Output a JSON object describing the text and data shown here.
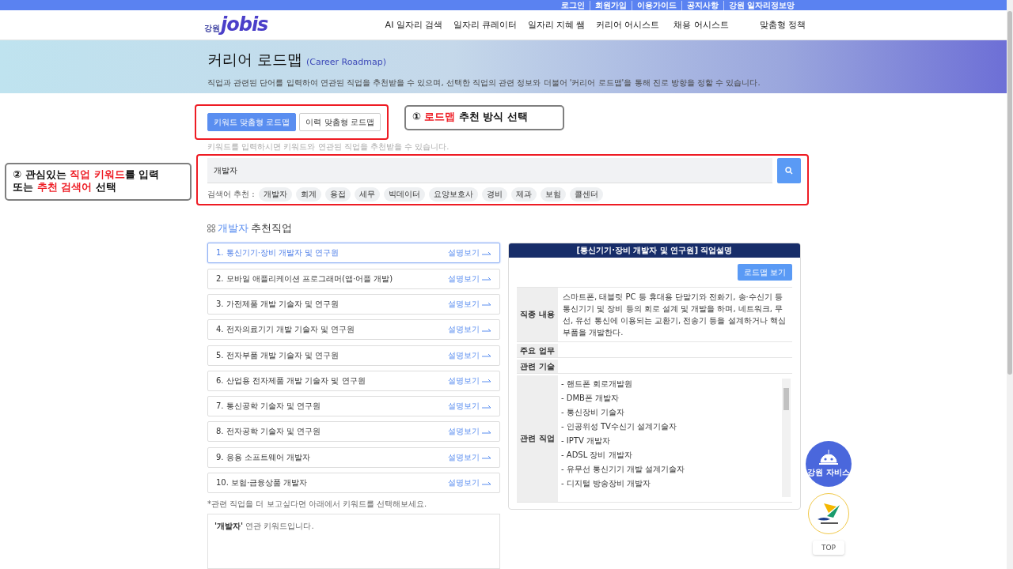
{
  "top_links": [
    "로그인",
    "회원가입",
    "이용가이드",
    "공지사항",
    "강원 일자리정보망"
  ],
  "logo": {
    "region": "강원",
    "name": "jobis"
  },
  "nav": [
    "AI 일자리 검색",
    "일자리 큐레이터",
    "일자리 지혜 쌤",
    "커리어 어시스트",
    "채용 어시스트",
    "맞춤형 정책"
  ],
  "banner": {
    "title": "커리어 로드맵",
    "subtitle": "(Career Roadmap)",
    "description": "직업과 관련된 단어를 입력하여 연관된 직업을 추천받을 수 있으며, 선택한 직업의 관련 정보와 더불어 '커리어 로드맵'을 통해 진로 방향을 정할 수 있습니다."
  },
  "tabs": [
    {
      "label": "키워드 맞춤형 로드맵",
      "selected": true
    },
    {
      "label": "이력 맞춤형 로드맵",
      "selected": false
    }
  ],
  "hint": "키워드를 입력하시면 키워드와 연관된 직업을 추천받을 수 있습니다.",
  "search": {
    "value": "개발자"
  },
  "suggest": {
    "label": "검색어 추천 :",
    "chips": [
      "개발자",
      "회계",
      "용접",
      "세무",
      "빅데이터",
      "요양보호사",
      "경비",
      "제과",
      "보험",
      "콜센터"
    ]
  },
  "section": {
    "keyword": "개발자",
    "rest": "추천직업"
  },
  "jobs": [
    {
      "title": "1. 통신기기·장비 개발자 및 연구원",
      "link": "설명보기",
      "selected": true
    },
    {
      "title": "2. 모바일 애플리케이션 프로그래머(앱·어플 개발)",
      "link": "설명보기",
      "selected": false
    },
    {
      "title": "3. 가전제품 개발 기술자 및 연구원",
      "link": "설명보기",
      "selected": false
    },
    {
      "title": "4. 전자의료기기 개발 기술자 및 연구원",
      "link": "설명보기",
      "selected": false
    },
    {
      "title": "5. 전자부품 개발 기술자 및 연구원",
      "link": "설명보기",
      "selected": false
    },
    {
      "title": "6. 산업용 전자제품 개발 기술자 및 연구원",
      "link": "설명보기",
      "selected": false
    },
    {
      "title": "7. 통신공학 기술자 및 연구원",
      "link": "설명보기",
      "selected": false
    },
    {
      "title": "8. 전자공학 기술자 및 연구원",
      "link": "설명보기",
      "selected": false
    },
    {
      "title": "9. 응용 소프트웨어 개발자",
      "link": "설명보기",
      "selected": false
    },
    {
      "title": "10. 보험·금융상품 개발자",
      "link": "설명보기",
      "selected": false
    }
  ],
  "more_note": "*관련 직업을 더 보고싶다면 아래에서 키워드를 선택해보세요.",
  "related": {
    "keyword": "'개발자'",
    "text": "연관 키워드입니다."
  },
  "detail": {
    "title": "[통신기기·장비 개발자 및 연구원] 직업설명",
    "button": "로드맵 보기",
    "rows": [
      {
        "label": "직종 내용",
        "kind": "text",
        "text": "스마트폰, 태블릿 PC 등 휴대용 단말기와 전화기, 송·수신기 등 통신기기 및 장비 등의 회로 설계 및 개발을 하며, 네트워크, 무선, 유선 통신에 이용되는 교환기, 전송기 등을 설계하거나 핵심부품을 개발한다."
      },
      {
        "label": "주요 업무",
        "kind": "text",
        "text": ""
      },
      {
        "label": "관련 기술",
        "kind": "text",
        "text": ""
      },
      {
        "label": "관련 직업",
        "kind": "list",
        "items": [
          "- 핸드폰 회로개발원",
          "- DMB폰 개발자",
          "- 통신장비 기술자",
          "- 인공위성 TV수신기 설계기술자",
          "- IPTV 개발자",
          "- ADSL 장비 개발자",
          "- 유무선 통신기기 개발 설계기술자",
          "- 디지털 방송장비 개발자"
        ]
      }
    ]
  },
  "floating": {
    "chatbot": "강원 자비스",
    "top": "TOP"
  },
  "annotations": [
    {
      "number": "①",
      "parts": [
        {
          "text": "로드맵",
          "highlight": true
        },
        {
          "text": " 추천 방식 선택",
          "highlight": false
        }
      ]
    },
    {
      "number": "②",
      "parts": [
        {
          "text": "관심있는 ",
          "highlight": false
        },
        {
          "text": "직업 키워드",
          "highlight": true
        },
        {
          "text": "를 입력",
          "highlight": false
        },
        {
          "text": "\n또는 ",
          "highlight": false
        },
        {
          "text": "추천 검색어",
          "highlight": true
        },
        {
          "text": " 선택",
          "highlight": false
        }
      ]
    }
  ]
}
